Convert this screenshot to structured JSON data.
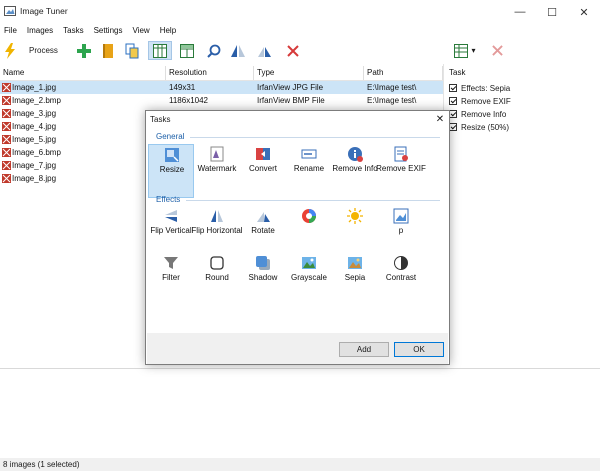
{
  "window": {
    "title": "Image Tuner",
    "minimize": "—",
    "maximize": "☐",
    "close": "✕"
  },
  "menu": [
    "File",
    "Images",
    "Tasks",
    "Settings",
    "View",
    "Help"
  ],
  "toolbar": {
    "process_label": "Process",
    "view_icon": "table-view-icon",
    "dropdown": "▾"
  },
  "list": {
    "columns": [
      "Name",
      "Resolution",
      "Type",
      "Path"
    ],
    "rows": [
      {
        "name": "Image_1.jpg",
        "resolution": "149x31",
        "type": "IrfanView JPG File",
        "path": "E:\\Image test\\",
        "selected": true
      },
      {
        "name": "Image_2.bmp",
        "resolution": "1186x1042",
        "type": "IrfanView BMP File",
        "path": "E:\\Image test\\"
      },
      {
        "name": "Image_3.jpg",
        "resolution": "",
        "type": "",
        "path": ""
      },
      {
        "name": "Image_4.jpg",
        "resolution": "",
        "type": "",
        "path": ""
      },
      {
        "name": "Image_5.jpg",
        "resolution": "",
        "type": "",
        "path": ""
      },
      {
        "name": "Image_6.bmp",
        "resolution": "",
        "type": "",
        "path": ""
      },
      {
        "name": "Image_7.jpg",
        "resolution": "",
        "type": "",
        "path": ""
      },
      {
        "name": "Image_8.jpg",
        "resolution": "",
        "type": "",
        "path": ""
      }
    ]
  },
  "task_panel": {
    "header": "Task",
    "items": [
      "Effects: Sepia",
      "Remove EXIF",
      "Remove Info",
      "Resize (50%)"
    ]
  },
  "status": "8 images (1 selected)",
  "dialog": {
    "title": "Tasks",
    "close": "✕",
    "general_label": "General",
    "effects_label": "Effects",
    "general": [
      {
        "label": "Resize",
        "icon": "resize-icon"
      },
      {
        "label": "Watermark",
        "icon": "watermark-icon"
      },
      {
        "label": "Convert",
        "icon": "convert-icon"
      },
      {
        "label": "Rename",
        "icon": "rename-icon"
      },
      {
        "label": "Remove Info",
        "icon": "remove-info-icon"
      },
      {
        "label": "Remove EXIF",
        "icon": "remove-exif-icon"
      }
    ],
    "effects_row1": [
      {
        "label": "Flip Vertical",
        "icon": "flip-vertical-icon"
      },
      {
        "label": "Flip Horizontal",
        "icon": "flip-horizontal-icon"
      },
      {
        "label": "Rotate",
        "icon": "rotate-icon"
      },
      {
        "label": "",
        "icon": "colors-icon"
      },
      {
        "label": "",
        "icon": "brightness-icon"
      },
      {
        "label": "p",
        "icon": "crop-icon"
      }
    ],
    "effects_row2": [
      {
        "label": "Filter",
        "icon": "filter-icon"
      },
      {
        "label": "Round",
        "icon": "round-icon"
      },
      {
        "label": "Shadow",
        "icon": "shadow-icon"
      },
      {
        "label": "Grayscale",
        "icon": "grayscale-icon"
      },
      {
        "label": "Sepia",
        "icon": "sepia-icon"
      },
      {
        "label": "Contrast",
        "icon": "contrast-icon"
      }
    ],
    "add_label": "Add",
    "ok_label": "OK"
  }
}
